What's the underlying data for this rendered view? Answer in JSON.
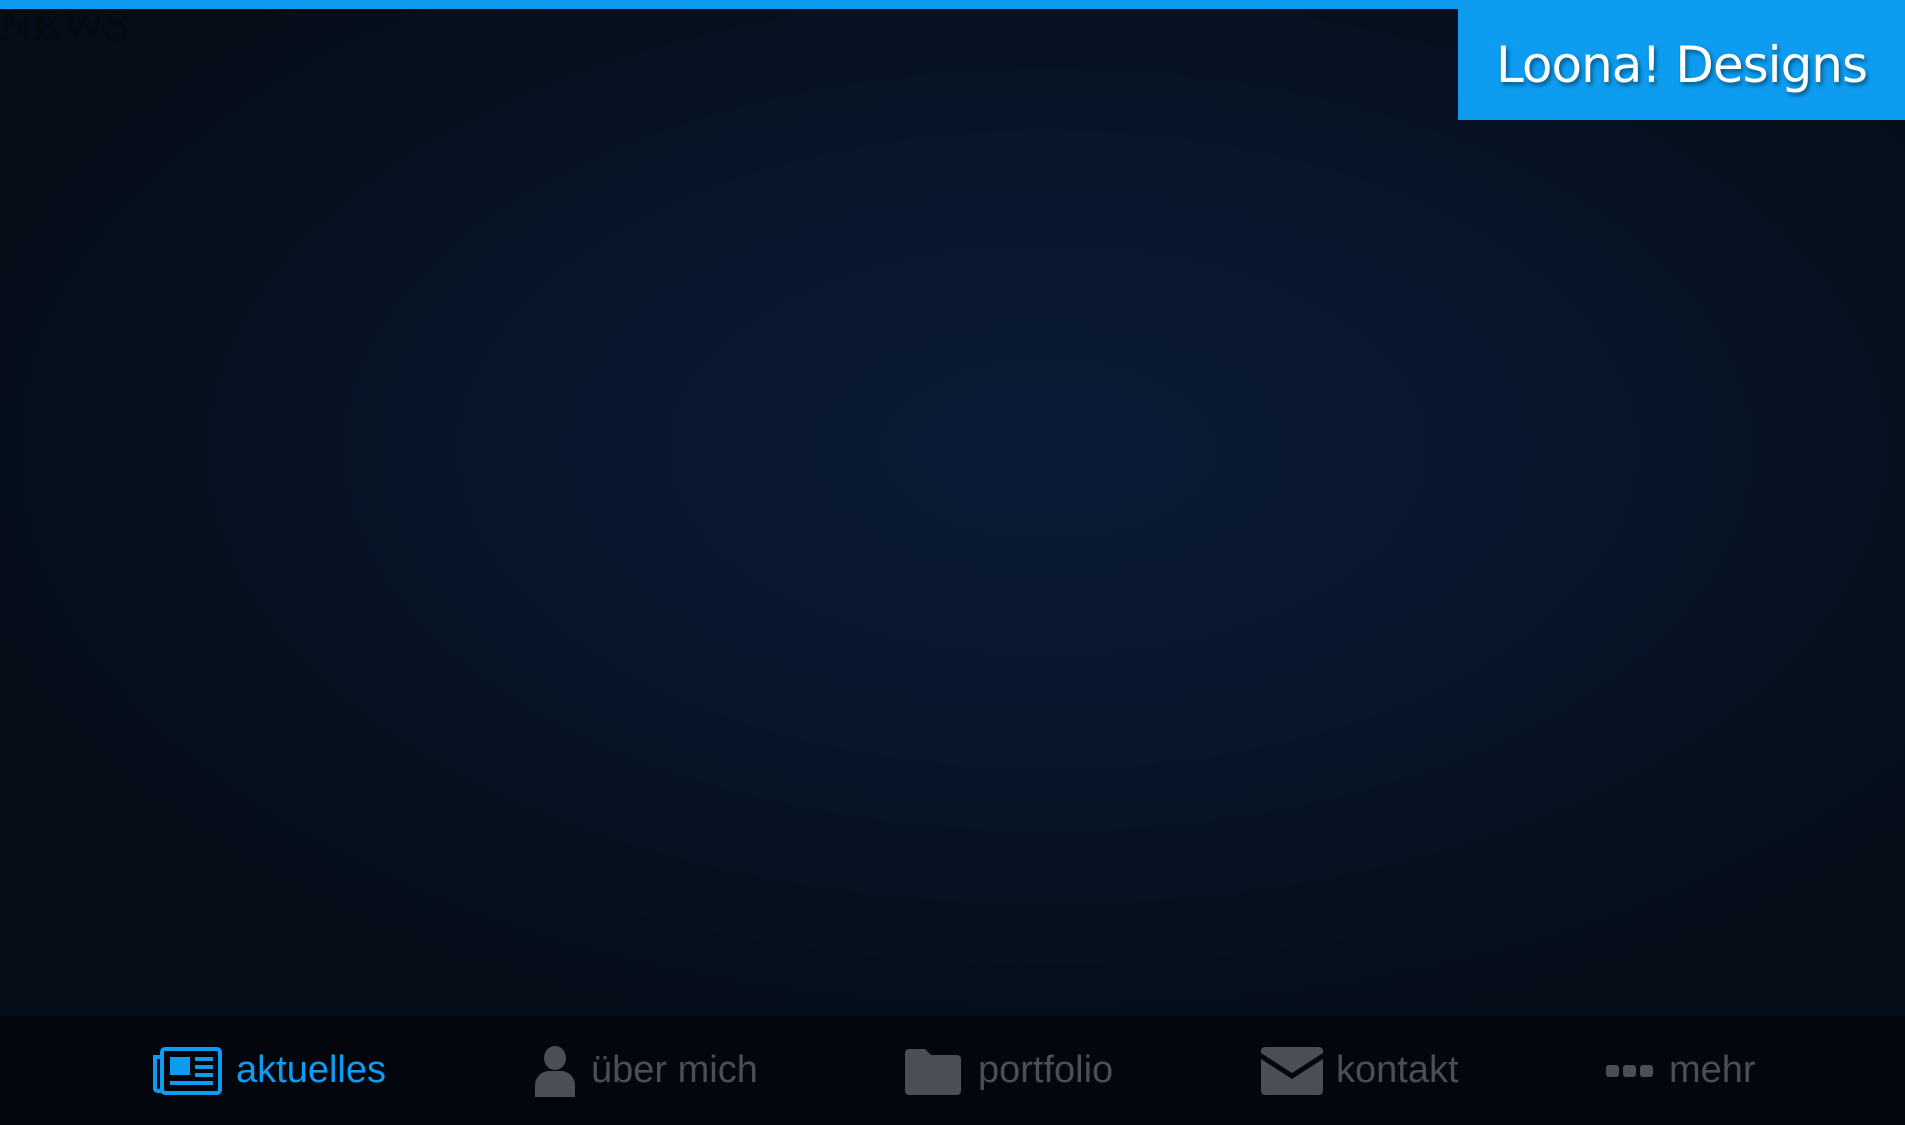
{
  "header": {
    "section_title": "NEWS",
    "brand": "Loona! Designs"
  },
  "nav": {
    "items": [
      {
        "label": "aktuelles",
        "icon": "newspaper-icon",
        "active": true
      },
      {
        "label": "über mich",
        "icon": "user-icon",
        "active": false
      },
      {
        "label": "portfolio",
        "icon": "folder-icon",
        "active": false
      },
      {
        "label": "kontakt",
        "icon": "envelope-icon",
        "active": false
      },
      {
        "label": "mehr",
        "icon": "ellipsis-icon",
        "active": false
      }
    ]
  },
  "colors": {
    "accent": "#0d9cf0",
    "nav_inactive": "#4a4e55",
    "nav_background": "#03070d",
    "page_background": "#08162c"
  }
}
